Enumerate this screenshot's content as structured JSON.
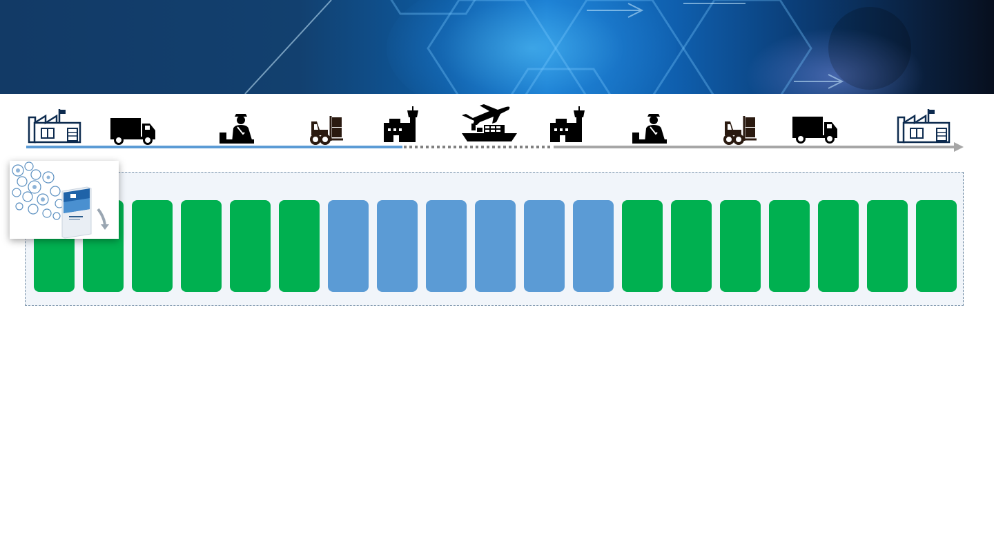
{
  "colors": {
    "banner_dark": "#123a66",
    "banner_light": "#1a7fd0",
    "line_blue": "#5b9bd5",
    "line_gray": "#a6a6a6",
    "step_green": "#00b050",
    "step_blue": "#5b9bd5",
    "panel_bg": "#f1f5fa",
    "icon_dark": "#000000",
    "icon_navy": "#0d2b4f"
  },
  "journey": {
    "icons": [
      {
        "name": "factory-icon"
      },
      {
        "name": "truck-icon"
      },
      {
        "name": "customs-officer-icon"
      },
      {
        "name": "forklift-icon"
      },
      {
        "name": "airport-terminal-icon"
      },
      {
        "name": "plane-and-ship-icon"
      },
      {
        "name": "airport-terminal-icon"
      },
      {
        "name": "customs-officer-icon"
      },
      {
        "name": "forklift-icon"
      },
      {
        "name": "truck-icon"
      },
      {
        "name": "factory-icon"
      }
    ]
  },
  "process_steps": [
    {
      "status": "green"
    },
    {
      "status": "green"
    },
    {
      "status": "green"
    },
    {
      "status": "green"
    },
    {
      "status": "green"
    },
    {
      "status": "green"
    },
    {
      "status": "blue"
    },
    {
      "status": "blue"
    },
    {
      "status": "blue"
    },
    {
      "status": "blue"
    },
    {
      "status": "blue"
    },
    {
      "status": "blue"
    },
    {
      "status": "green"
    },
    {
      "status": "green"
    },
    {
      "status": "green"
    },
    {
      "status": "green"
    },
    {
      "status": "green"
    },
    {
      "status": "green"
    },
    {
      "status": "green"
    }
  ],
  "thumbnail": {
    "icon": "document-cover-icon"
  }
}
